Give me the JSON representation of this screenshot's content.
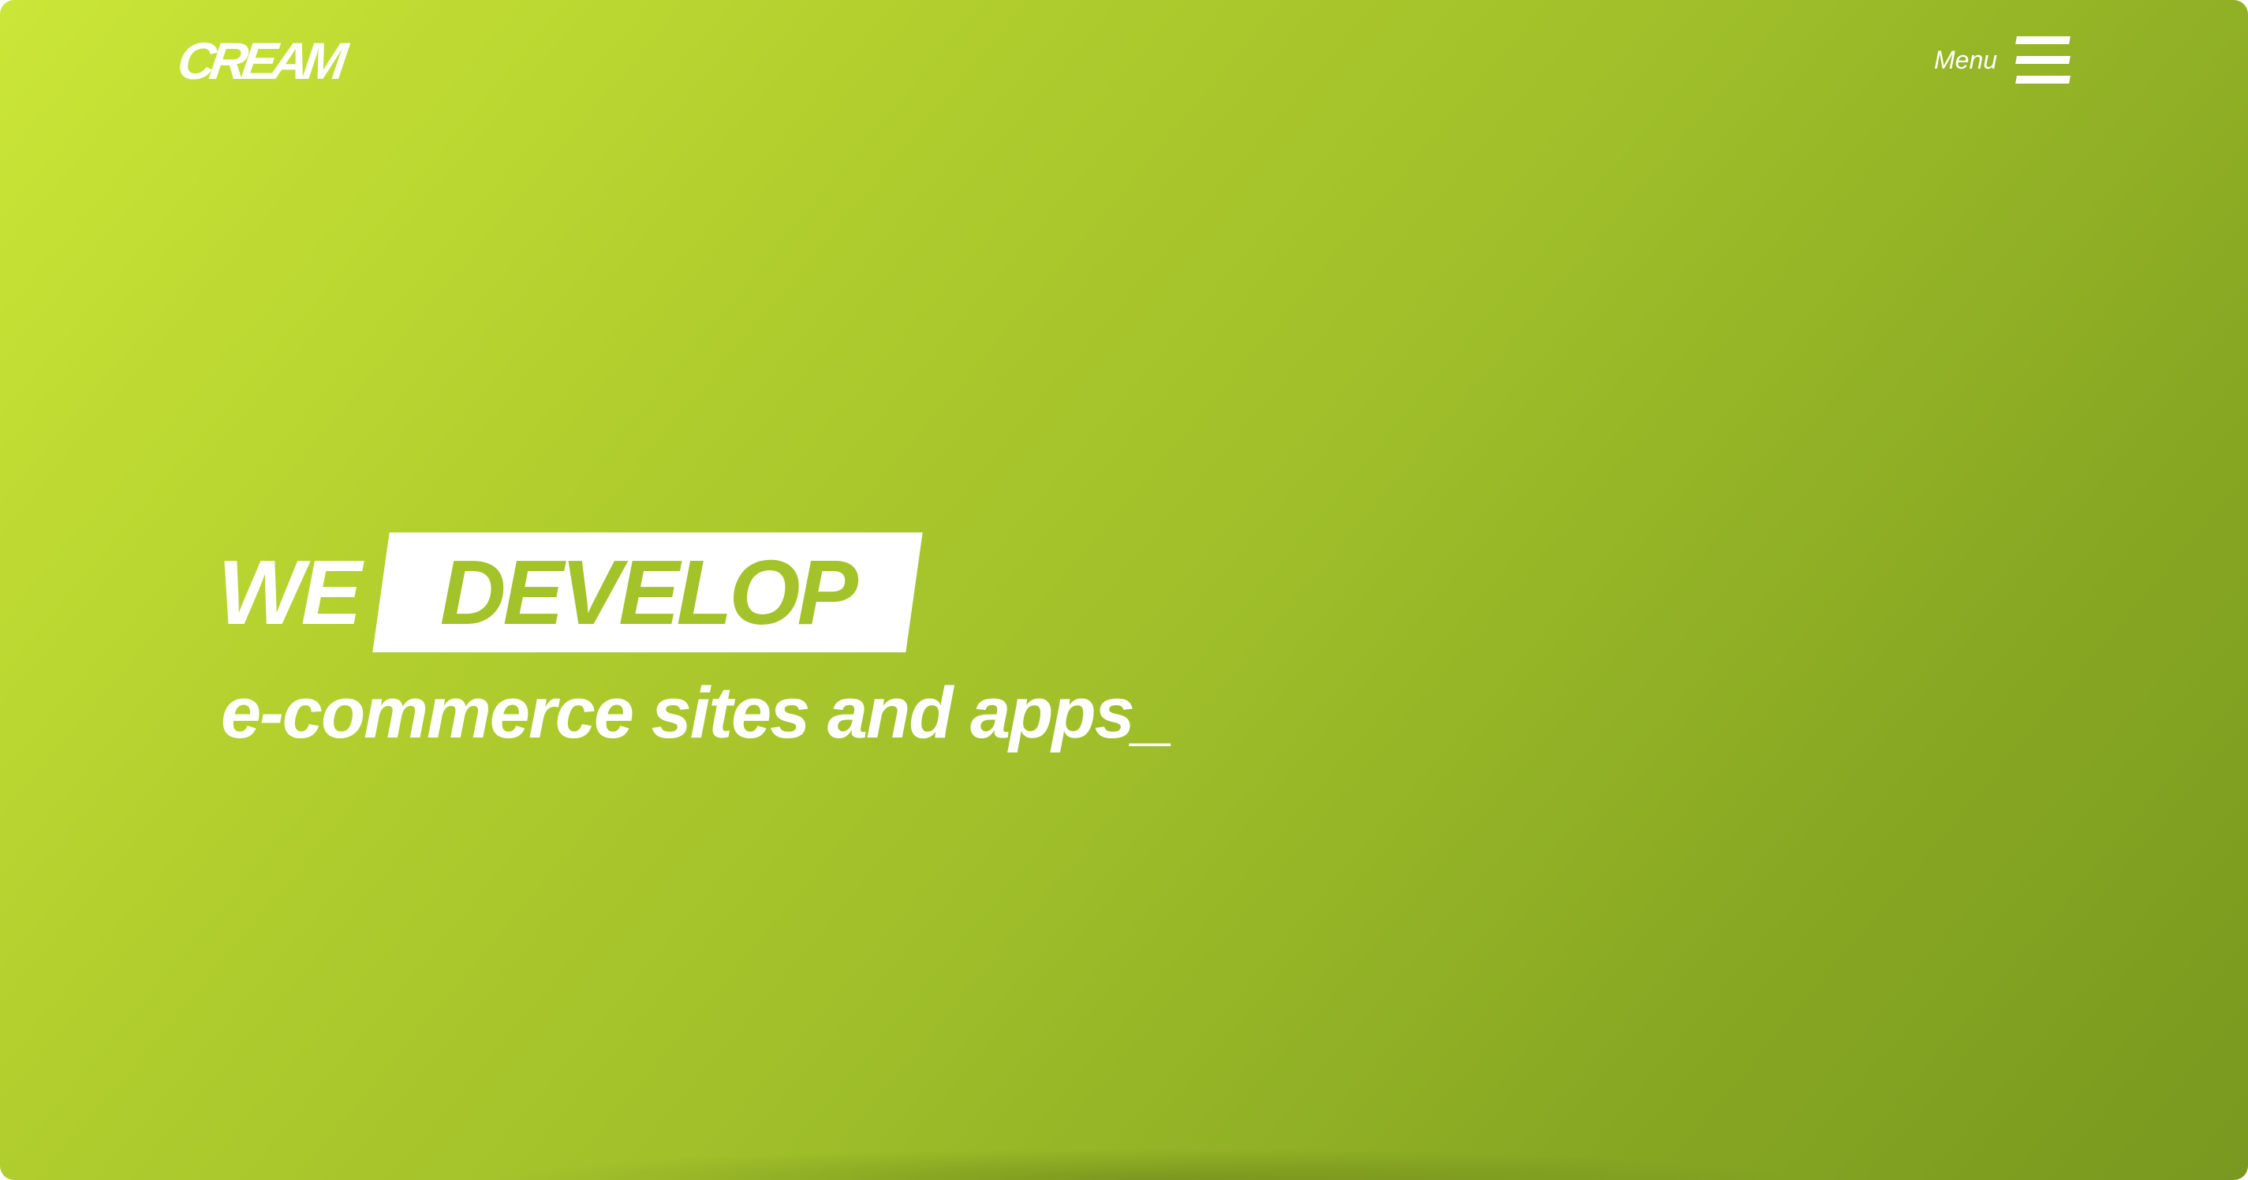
{
  "header": {
    "logo_text": "CREAM",
    "menu_label": "Menu",
    "menu_icon": "hamburger-icon"
  },
  "hero": {
    "headline_prefix": "WE",
    "headline_highlight": "DEVELOP",
    "subheadline": "e-commerce sites and apps_"
  },
  "colors": {
    "gradient_start": "#cbe637",
    "gradient_end": "#78981f",
    "highlight_text": "#a4c22a",
    "foreground": "#ffffff"
  }
}
